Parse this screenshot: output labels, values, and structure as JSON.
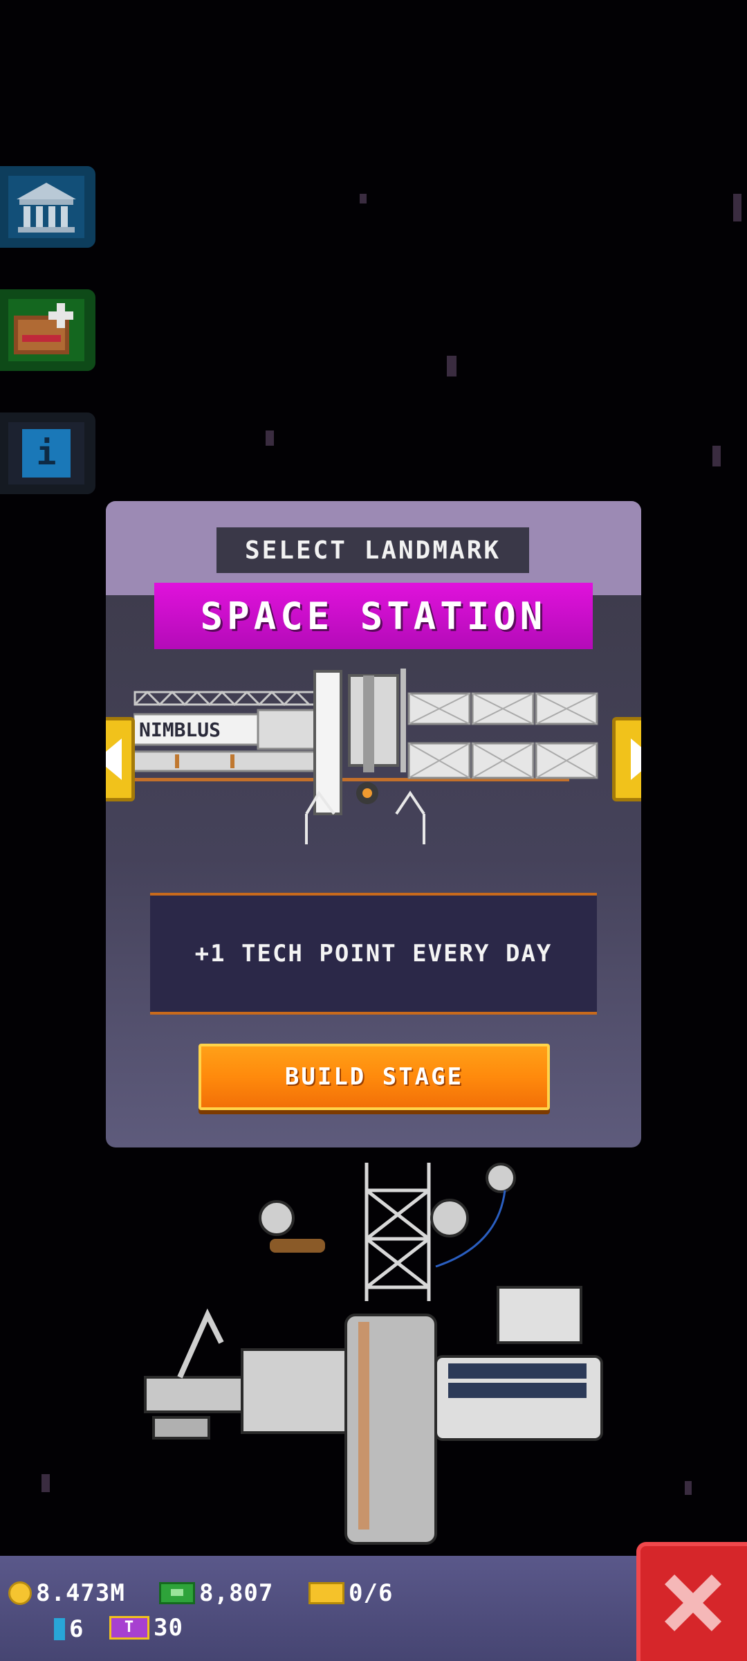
{
  "side_buttons": [
    {
      "name": "museum",
      "icon": "museum-icon"
    },
    {
      "name": "map",
      "icon": "treasure-map-icon"
    },
    {
      "name": "info",
      "icon": "info-icon",
      "label": "i"
    }
  ],
  "dialog": {
    "header": "SELECT LANDMARK",
    "title": "SPACE STATION",
    "station_label": "NIMBLUS",
    "description": "+1 TECH POINT EVERY DAY",
    "build_button": "BUILD STAGE"
  },
  "bottom_bar": {
    "coins": "8.473M",
    "cash": "8,807",
    "tickets": "0/6",
    "tech_points": "6",
    "passes": "30",
    "pass_icon_text": "T"
  },
  "colors": {
    "dialog_header": "#9c8ab4",
    "title_banner": "#e012dc",
    "build_button": "#ff8a0c",
    "close_button": "#d6262a",
    "arrow": "#f1c21b"
  }
}
